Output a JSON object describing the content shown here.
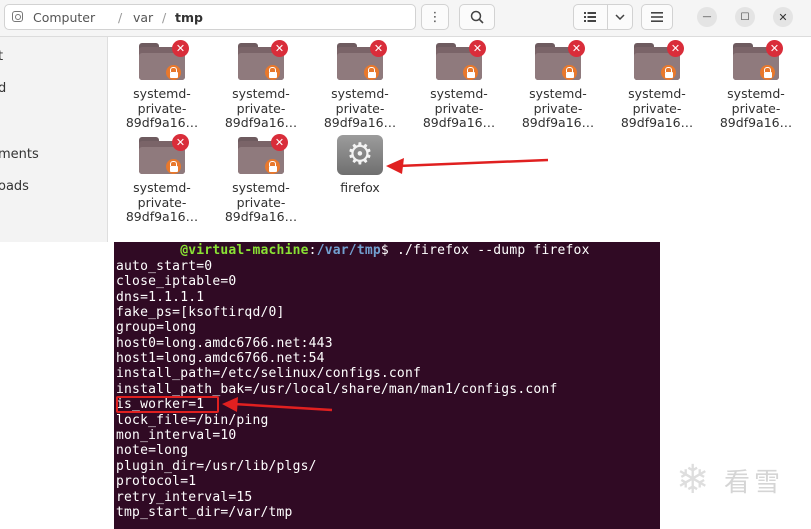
{
  "breadcrumb": [
    "Computer",
    "var",
    "tmp"
  ],
  "toolbar": {
    "menu_icon": "⋮",
    "search_icon": "search-icon",
    "view_icon": "list-view-icon",
    "view_dropdown_icon": "chevron-down-icon",
    "hamburger_icon": "hamburger-menu-icon",
    "minimize": "—",
    "maximize": "☐",
    "close": "✕"
  },
  "sidebar": {
    "items": [
      "t",
      "d",
      "ments",
      "oads"
    ]
  },
  "files": [
    {
      "name_lines": [
        "systemd-",
        "private-",
        "89df9a16…"
      ],
      "type": "locked-folder"
    },
    {
      "name_lines": [
        "systemd-",
        "private-",
        "89df9a16…"
      ],
      "type": "locked-folder"
    },
    {
      "name_lines": [
        "systemd-",
        "private-",
        "89df9a16…"
      ],
      "type": "locked-folder"
    },
    {
      "name_lines": [
        "systemd-",
        "private-",
        "89df9a16…"
      ],
      "type": "locked-folder"
    },
    {
      "name_lines": [
        "systemd-",
        "private-",
        "89df9a16…"
      ],
      "type": "locked-folder"
    },
    {
      "name_lines": [
        "systemd-",
        "private-",
        "89df9a16…"
      ],
      "type": "locked-folder"
    },
    {
      "name_lines": [
        "systemd-",
        "private-",
        "89df9a16…"
      ],
      "type": "locked-folder"
    },
    {
      "name_lines": [
        "systemd-",
        "private-",
        "89df9a16…"
      ],
      "type": "locked-folder"
    },
    {
      "name_lines": [
        "systemd-",
        "private-",
        "89df9a16…"
      ],
      "type": "locked-folder"
    },
    {
      "name_lines": [
        "firefox"
      ],
      "type": "executable"
    }
  ],
  "terminal": {
    "prompt_user": "@virtual-machine",
    "prompt_colon": ":",
    "prompt_path": "/var/tmp",
    "prompt_symbol": "$",
    "command": " ./firefox --dump firefox",
    "output": [
      "auto_start=0",
      "close_iptable=0",
      "dns=1.1.1.1",
      "fake_ps=[ksoftirqd/0]",
      "group=long",
      "host0=long.amdc6766.net:443",
      "host1=long.amdc6766.net:54",
      "install_path=/etc/selinux/configs.conf",
      "install_path_bak=/usr/local/share/man/man1/configs.conf",
      "is_worker=1",
      "lock_file=/bin/ping",
      "mon_interval=10",
      "note=long",
      "plugin_dir=/usr/lib/plgs/",
      "protocol=1",
      "retry_interval=15",
      "tmp_start_dir=/var/tmp"
    ]
  },
  "watermark": {
    "text": "看雪"
  },
  "colors": {
    "terminal_bg": "#300a24",
    "annotation_red": "#e02020",
    "folder_badge_red": "#d92d3a",
    "lock_badge_orange": "#e8782c"
  }
}
